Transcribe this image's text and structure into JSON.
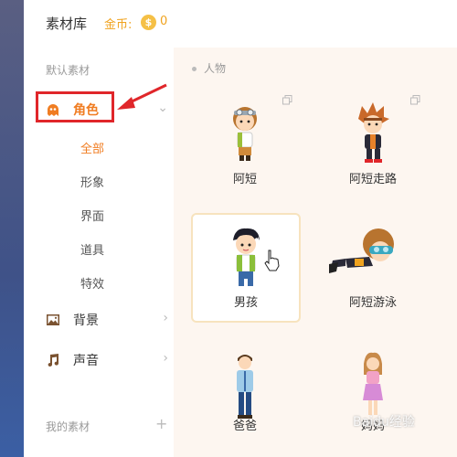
{
  "header": {
    "title": "素材库",
    "coin_label": "金币:",
    "coin_symbol": "$",
    "coin_count": "0"
  },
  "sidebar": {
    "default_title": "默认素材",
    "items": [
      {
        "label": "角色",
        "icon": "ghost-icon",
        "active": true
      },
      {
        "label": "背景",
        "icon": "image-icon"
      },
      {
        "label": "声音",
        "icon": "music-note-icon"
      }
    ],
    "sub_items": [
      "全部",
      "形象",
      "界面",
      "道具",
      "特效"
    ],
    "my_title": "我的素材"
  },
  "content": {
    "category": "人物",
    "cards": [
      {
        "name": "阿短"
      },
      {
        "name": "阿短走路"
      },
      {
        "name": "男孩",
        "selected": true
      },
      {
        "name": "阿短游泳"
      },
      {
        "name": "爸爸"
      },
      {
        "name": "妈妈"
      }
    ]
  },
  "colors": {
    "accent": "#f07d22",
    "highlight": "#e0262a",
    "coin": "#f5c046"
  },
  "watermark": "Baidu经验"
}
